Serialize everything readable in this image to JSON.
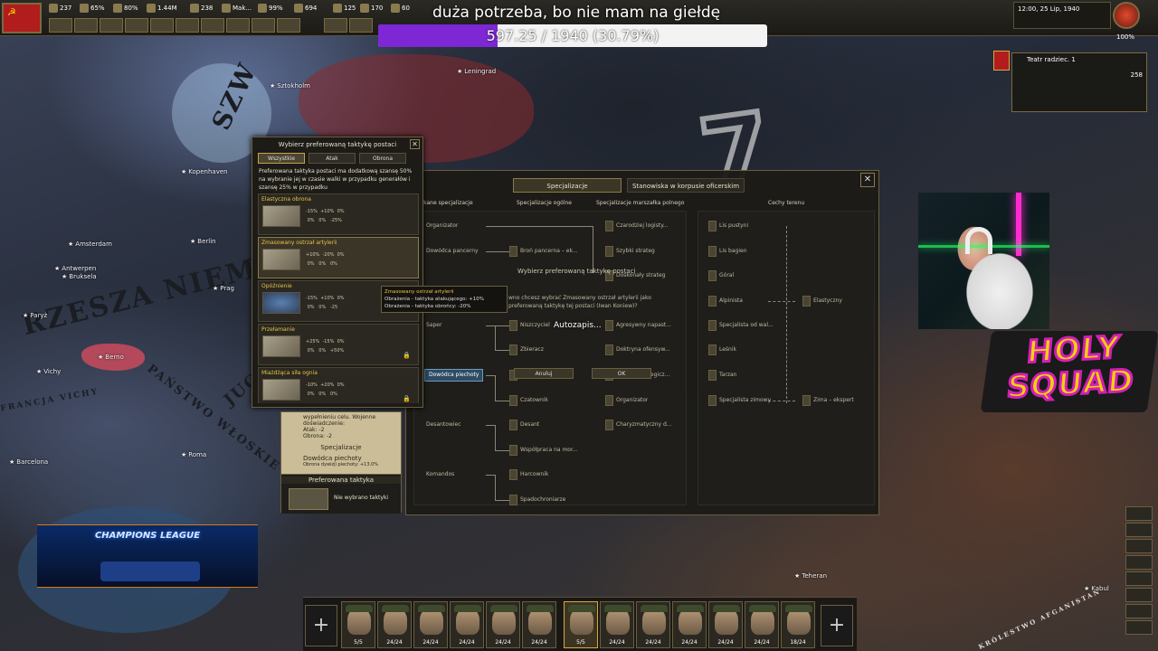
{
  "stream": {
    "message": "duża potrzeba, bo nie mam na giełdę",
    "goal_text": "597.25 / 1940 (30.79%)",
    "goal_fraction": 0.3079,
    "goal_color": "#7e27d4"
  },
  "topbar": {
    "resources": [
      "237",
      "65%",
      "80%",
      "1.44M",
      "238",
      "Mak...",
      "99%",
      "694",
      "125",
      "170",
      "60"
    ],
    "clock": "12:00, 25 Lip, 1940",
    "speed_pct": "100%"
  },
  "theatre": {
    "title": "Teatr radziec. 1",
    "count": "258"
  },
  "map": {
    "labels": [
      "SZW",
      "RZESZA NIEMIECK",
      "PAŃSTWO WŁOSKIE",
      "FRANCJA VICHY",
      "JUG",
      "KRÓLESTWO AFGANISTAN",
      "ZESZA NIEMIECK"
    ],
    "cities": [
      "Leningrad",
      "Sztokholm",
      "Kopenhaven",
      "Amsterdam",
      "Berlin",
      "Antwerpen",
      "Bruksela",
      "Praga",
      "Paryż",
      "Berno",
      "Vichy",
      "Rzym",
      "Roma",
      "Barcelona",
      "Teheran",
      "Kabul",
      "Prag"
    ],
    "big_numeral": "7"
  },
  "tactic_popup": {
    "title": "Wybierz preferowaną taktykę postaci",
    "tabs": [
      "Wszystkie",
      "Atak",
      "Obrona"
    ],
    "description": "Preferowana taktyka postaci ma dodatkową szansę 50% na wybranie jej w czasie walki w przypadku generałów i szansę 25% w przypadku",
    "items": [
      {
        "name": "Elastyczna obrona",
        "stats": "-15%  +10%  0%\n 0%   0%   -25%",
        "locked": false
      },
      {
        "name": "Zmasowany ostrzał artylerii",
        "stats": "+10%  -20%  0%\n 0%   0%   0%",
        "locked": false
      },
      {
        "name": "Opóźnienie",
        "stats": "-15%  +10%  0%\n 0%   0%   -25",
        "locked": false
      },
      {
        "name": "Przełamanie",
        "stats": "+25%  -15%  0%\n 0%   0%   +50%",
        "locked": true
      },
      {
        "name": "Miażdżąca siła ognia",
        "stats": "-10%  +20%  0%\n 0%   0%   0%",
        "locked": true
      }
    ]
  },
  "tooltip": {
    "title": "Zmasowany ostrzał artylerii",
    "line1": "Obrażenia - taktyka atakującego: +10%",
    "line2": "Obrażenia - taktyka obrońcy: -20%"
  },
  "officer_window": {
    "tabs": [
      "Specjalizacje",
      "Stanowiska w korpusie oficerskim"
    ],
    "columns": [
      "skane specjalizacje",
      "Specjalizacje ogólne",
      "Specjalizacje marszałka polnego",
      "Cechy terenu"
    ],
    "col1": [
      "Organizator",
      "Dowódca pancerny",
      "Saper",
      "Dowódca piechoty",
      "Desantowiec",
      "Komandos"
    ],
    "col2": [
      "Broń pancerna – ek...",
      "Niszczyciel",
      "Zbieracz",
      "Plan... ekspert",
      "Czatownik",
      "Desant",
      "Współpraca na mor...",
      "Harcownik",
      "Spadochroniarze"
    ],
    "col3": [
      "Czarodziej logisty...",
      "Szybki strateg",
      "Doskonały strateg",
      "Agresywny napast...",
      "Doktryna ofensyw...",
      "Obrona strategicz...",
      "Organizator",
      "Charyzmatyczny d..."
    ],
    "col4": [
      "Lis pustyni",
      "Lis bagien",
      "Góral",
      "Alpinista",
      "Specjalista od wal...",
      "Leśnik",
      "Tarzan",
      "Specjalista zimowy"
    ],
    "col5": [
      "Elastyczny",
      "Zima – ekspert"
    ],
    "confirm": {
      "title": "Wybierz preferowaną taktykę postaci",
      "body": "wno chcesz wybrać Zmasowany ostrzał artylerii jako preferowaną taktykę tej postaci (Iwan Koniew)?",
      "cancel": "Anuluj",
      "ok": "OK"
    },
    "autosave": "Autozapis..."
  },
  "general_card": {
    "lines": [
      "wypełnieniu celu. Wojenne",
      "doświadczenie:",
      "Atak: -2",
      "Obrona: -2"
    ],
    "spec_title": "Specjalizacje",
    "spec_name": "Dowódca piechoty",
    "spec_effect": "Obrona dywizji piechoty: +13.0%",
    "pref_title": "Preferowana taktyka",
    "pref_value": "Nie wybrano taktyki"
  },
  "overlays": {
    "holy_squad_line1": "HOLY",
    "holy_squad_line2": "SQUAD",
    "champions_league": "CHAMPIONS LEAGUE"
  },
  "commanders": [
    "5/5",
    "24/24",
    "24/24",
    "24/24",
    "24/24",
    "24/24",
    "5/5",
    "24/24",
    "24/24",
    "24/24",
    "24/24",
    "24/24",
    "18/24"
  ]
}
